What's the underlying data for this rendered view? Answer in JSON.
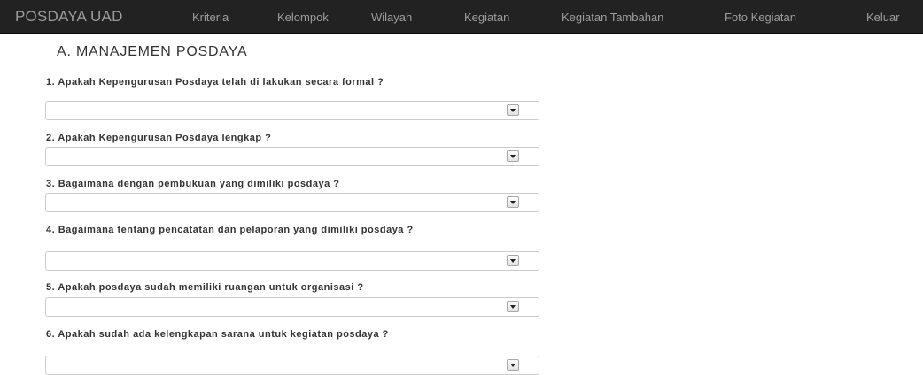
{
  "navbar": {
    "brand": "POSDAYA UAD",
    "items": [
      {
        "label": "Kriteria"
      },
      {
        "label": "Kelompok"
      },
      {
        "label": "Wilayah"
      },
      {
        "label": "Kegiatan"
      },
      {
        "label": "Kegiatan Tambahan"
      },
      {
        "label": "Foto Kegiatan"
      },
      {
        "label": "Keluar"
      }
    ]
  },
  "main": {
    "section_title": "A. MANAJEMEN POSDAYA",
    "questions": [
      {
        "text": "1. Apakah Kepengurusan Posdaya telah di lakukan secara formal ?",
        "selected": ""
      },
      {
        "text": "2. Apakah Kepengurusan Posdaya lengkap ?",
        "selected": ""
      },
      {
        "text": "3. Bagaimana dengan pembukuan yang dimiliki posdaya ?",
        "selected": ""
      },
      {
        "text": "4. Bagaimana tentang pencatatan dan pelaporan yang dimiliki posdaya ?",
        "selected": ""
      },
      {
        "text": "5. Apakah posdaya sudah memiliki ruangan untuk organisasi ?",
        "selected": ""
      },
      {
        "text": "6. Apakah sudah ada kelengkapan sarana untuk kegiatan posdaya ?",
        "selected": ""
      }
    ]
  }
}
